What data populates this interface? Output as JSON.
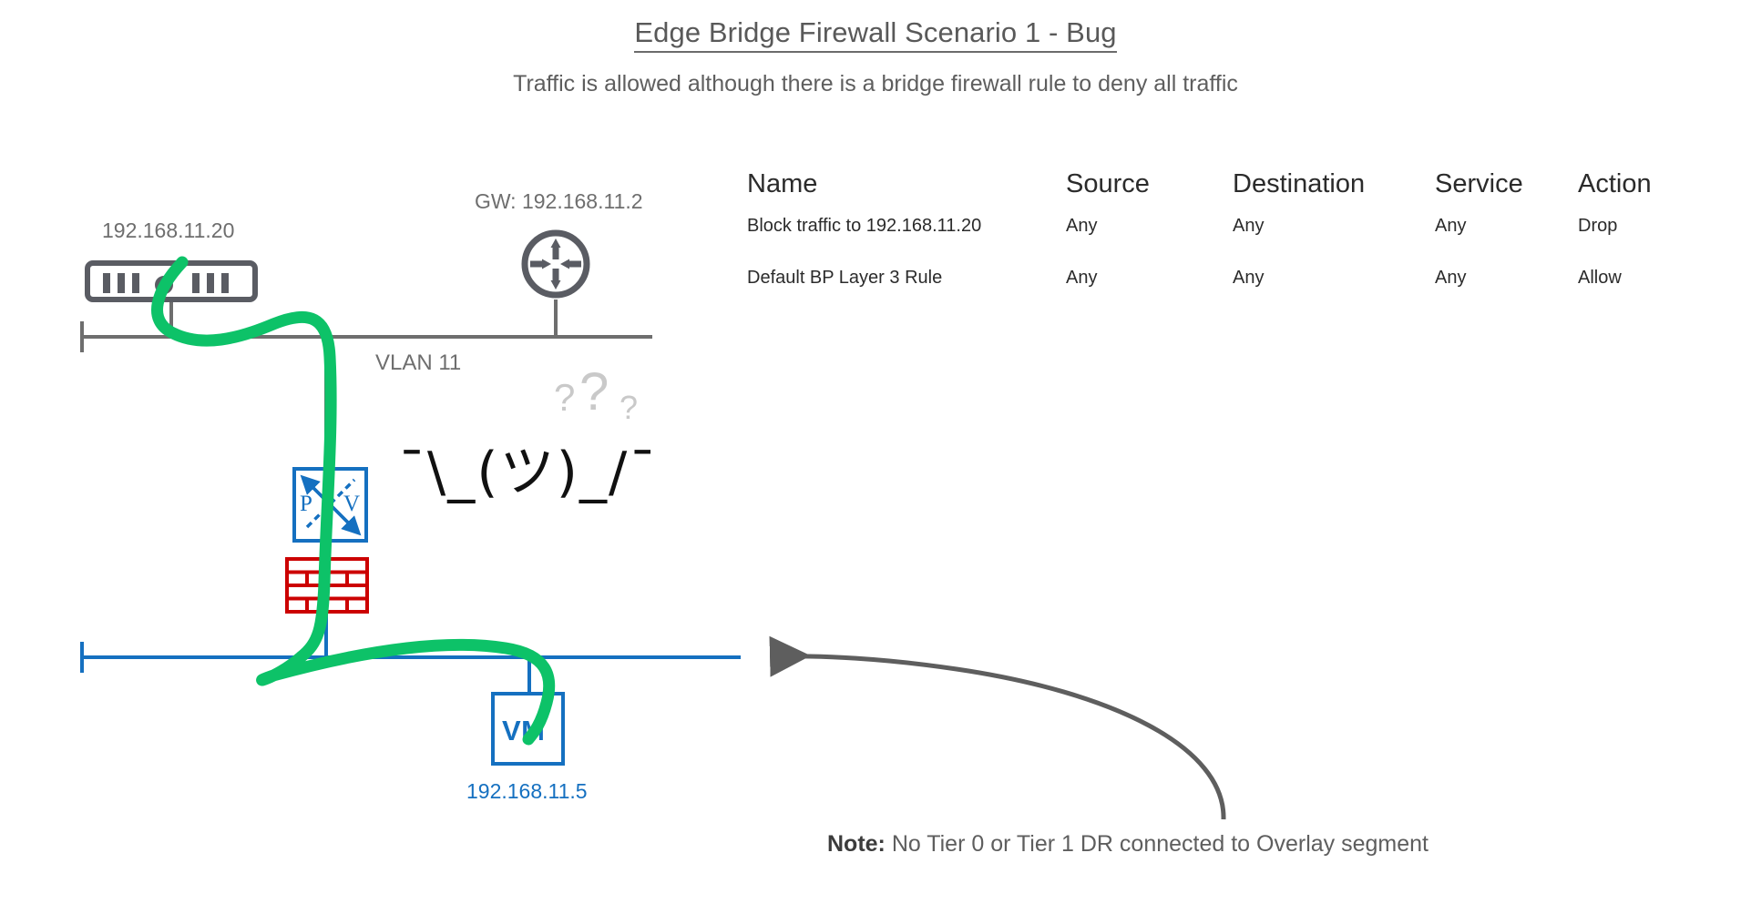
{
  "header": {
    "title": "Edge Bridge Firewall Scenario 1 - Bug",
    "subtitle": "Traffic is allowed although there is a bridge firewall rule to deny all traffic"
  },
  "firewall_table": {
    "columns": [
      "Name",
      "Source",
      "Destination",
      "Service",
      "Action"
    ],
    "rows": [
      {
        "name": "Block traffic to 192.168.11.20",
        "source": "Any",
        "destination": "Any",
        "service": "Any",
        "action": "Drop"
      },
      {
        "name": "Default BP Layer 3 Rule",
        "source": "Any",
        "destination": "Any",
        "service": "Any",
        "action": "Allow"
      }
    ]
  },
  "diagram": {
    "server_ip_label": "192.168.11.20",
    "gateway_label": "GW: 192.168.11.2",
    "vlan_label": "VLAN 11",
    "pv_box_left_letter": "P",
    "pv_box_right_letter": "V",
    "vm_label": "VM",
    "vm_ip_label": "192.168.11.5",
    "shrug": "¯\\_(ツ)_/¯",
    "question_marks": [
      "?",
      "?",
      "?"
    ]
  },
  "note": {
    "prefix": "Note:",
    "text": " No Tier 0 or Tier 1 DR connected to Overlay segment"
  },
  "colors": {
    "traffic_flow_green": "#0dc268",
    "overlay_blue": "#1570c0",
    "firewall_red": "#cc0000",
    "vlan_gray": "#6e6e6e",
    "drop_action_red": "#cc0000"
  }
}
